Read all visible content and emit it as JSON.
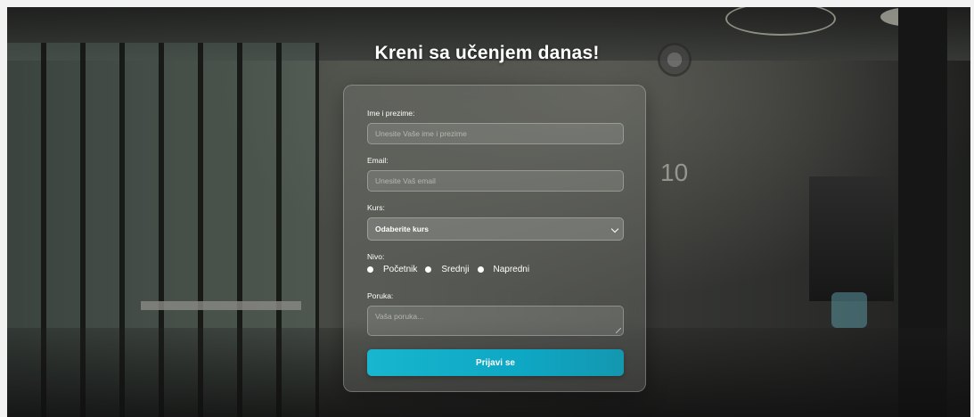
{
  "header": {
    "title": "Kreni sa učenjem danas!"
  },
  "background": {
    "room_number": "10"
  },
  "form": {
    "name": {
      "label": "Ime i prezime:",
      "placeholder": "Unesite Vaše ime i prezime",
      "value": ""
    },
    "email": {
      "label": "Email:",
      "placeholder": "Unesite Vaš email",
      "value": ""
    },
    "course": {
      "label": "Kurs:",
      "selected": "Odaberite kurs"
    },
    "level": {
      "label": "Nivo:",
      "options": [
        "Početnik",
        "Srednji",
        "Napredni"
      ]
    },
    "message": {
      "label": "Poruka:",
      "placeholder": "Vaša poruka..."
    },
    "submit_label": "Prijavi se"
  },
  "colors": {
    "accent": "#0ea7c4",
    "text": "#ffffff"
  }
}
